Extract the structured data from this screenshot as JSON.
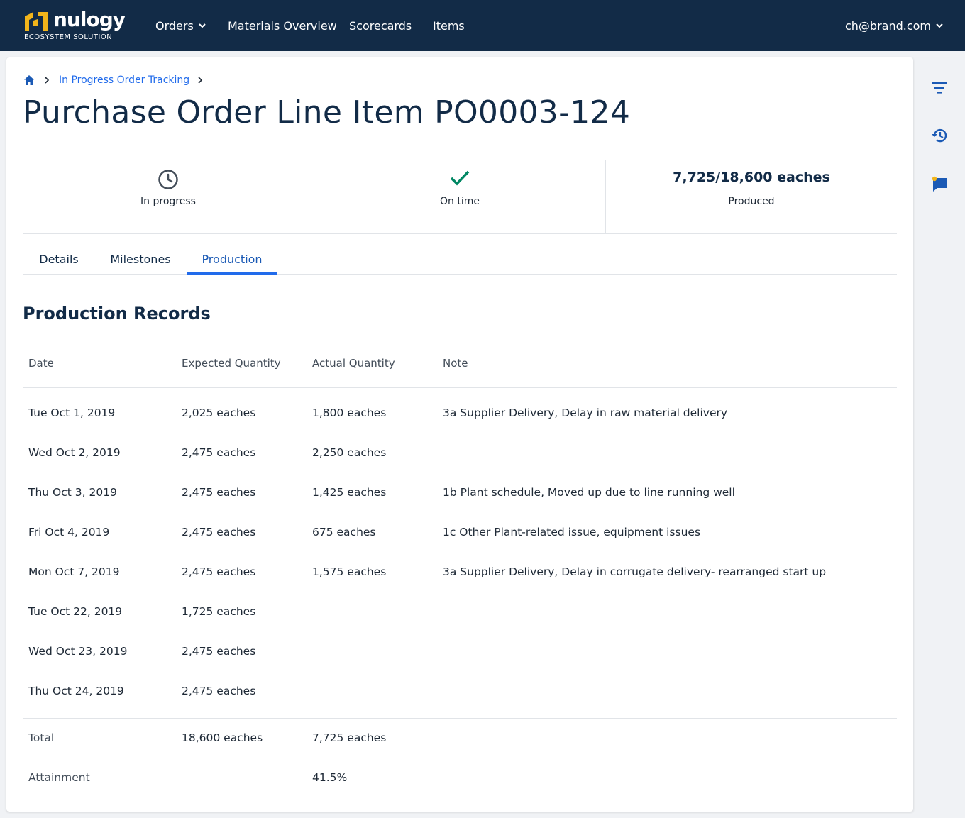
{
  "brand": {
    "name": "nulogy",
    "tagline": "ECOSYSTEM SOLUTION",
    "primary": "#122b47",
    "accent": "#216beb",
    "logo_color": "#f2b51b"
  },
  "nav": {
    "items": [
      {
        "label": "Orders"
      },
      {
        "label": "Materials Overview"
      },
      {
        "label": "Scorecards"
      },
      {
        "label": "Items"
      }
    ],
    "user": "ch@brand.com"
  },
  "breadcrumb": {
    "link": "In Progress Order Tracking"
  },
  "page": {
    "title": "Purchase Order Line Item PO0003-124"
  },
  "summary": {
    "status": "In progress",
    "timing": "On time",
    "produced_value": "7,725/18,600 eaches",
    "produced_label": "Produced"
  },
  "tabs": [
    {
      "label": "Details"
    },
    {
      "label": "Milestones"
    },
    {
      "label": "Production",
      "active": true
    }
  ],
  "production": {
    "title": "Production Records",
    "columns": [
      "Date",
      "Expected Quantity",
      "Actual Quantity",
      "Note"
    ],
    "rows": [
      {
        "date": "Tue Oct 1, 2019",
        "expected": "2,025 eaches",
        "actual": "1,800 eaches",
        "note": "3a Supplier Delivery, Delay in raw material delivery"
      },
      {
        "date": "Wed Oct 2, 2019",
        "expected": "2,475 eaches",
        "actual": "2,250 eaches",
        "note": ""
      },
      {
        "date": "Thu Oct 3, 2019",
        "expected": "2,475 eaches",
        "actual": "1,425 eaches",
        "note": "1b  Plant schedule, Moved up due to line running well"
      },
      {
        "date": "Fri Oct 4, 2019",
        "expected": "2,475 eaches",
        "actual": "675 eaches",
        "note": "1c  Other Plant-related issue, equipment issues"
      },
      {
        "date": "Mon Oct 7, 2019",
        "expected": "2,475 eaches",
        "actual": "1,575 eaches",
        "note": "3a Supplier Delivery, Delay in corrugate delivery- rearranged start up"
      },
      {
        "date": "Tue Oct 22, 2019",
        "expected": "1,725 eaches",
        "actual": "",
        "note": ""
      },
      {
        "date": "Wed Oct 23, 2019",
        "expected": "2,475 eaches",
        "actual": "",
        "note": ""
      },
      {
        "date": "Thu Oct 24, 2019",
        "expected": "2,475 eaches",
        "actual": "",
        "note": ""
      }
    ],
    "total": {
      "label": "Total",
      "expected": "18,600 eaches",
      "actual": "7,725 eaches"
    },
    "attainment": {
      "label": "Attainment",
      "actual": "41.5%"
    }
  },
  "side_icons": [
    "filter-icon",
    "history-icon",
    "comment-icon"
  ],
  "colors": {
    "success": "#008763",
    "notification": "#f2b51b"
  }
}
